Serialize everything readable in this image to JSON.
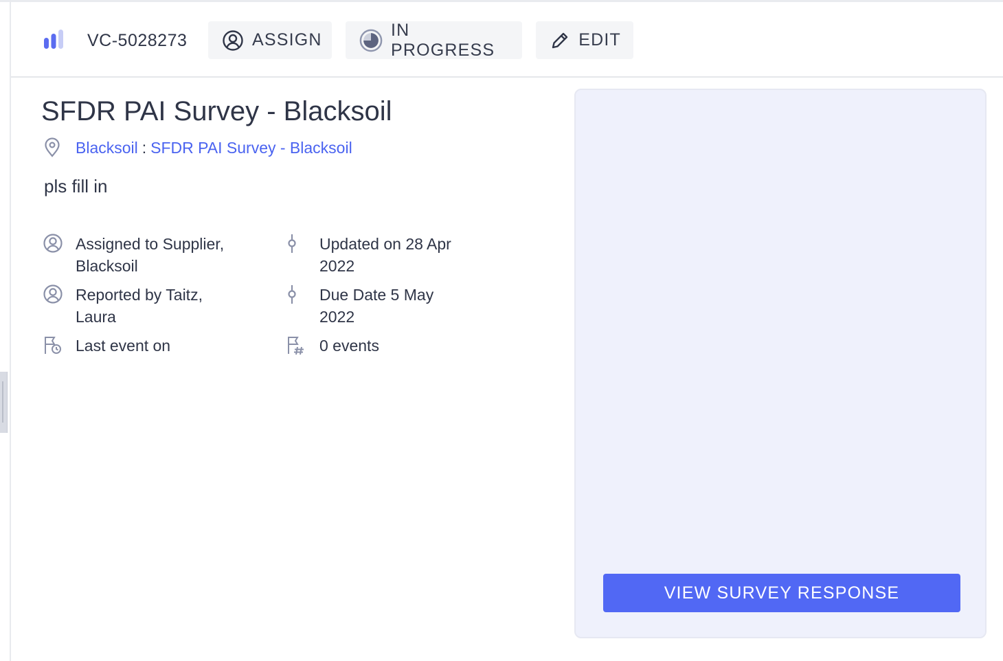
{
  "header": {
    "ticket_id": "VC-5028273",
    "assign_label": "ASSIGN",
    "status_label": "IN PROGRESS",
    "edit_label": "EDIT"
  },
  "task": {
    "title": "SFDR PAI Survey - Blacksoil",
    "breadcrumb": {
      "entity": "Blacksoil",
      "separator": ":",
      "survey": "SFDR PAI Survey - Blacksoil"
    },
    "description": "pls fill in"
  },
  "meta": {
    "assigned_line1": "Assigned to Supplier,",
    "assigned_line2": "Blacksoil",
    "reported_line1": "Reported by Taitz,",
    "reported_line2": "Laura",
    "last_event": "Last event on",
    "updated_line1": "Updated on 28 Apr",
    "updated_line2": "2022",
    "due_line1": "Due Date 5 May",
    "due_line2": "2022",
    "events_count": "0 events"
  },
  "panel": {
    "view_button_label": "VIEW SURVEY RESPONSE"
  },
  "colors": {
    "accent": "#5168f4",
    "link": "#4a63f0",
    "panel_bg": "#eff1fc",
    "text": "#2f3547",
    "icon": "#8a90a8"
  },
  "icons": {
    "logo": "bar-chart-icon",
    "assign": "user-circle-icon",
    "status": "progress-circle-icon",
    "edit": "pencil-icon",
    "location": "map-pin-icon",
    "person": "user-circle-icon",
    "timeline": "commit-node-icon",
    "last_event": "flag-clock-icon",
    "events": "flag-hash-icon"
  }
}
